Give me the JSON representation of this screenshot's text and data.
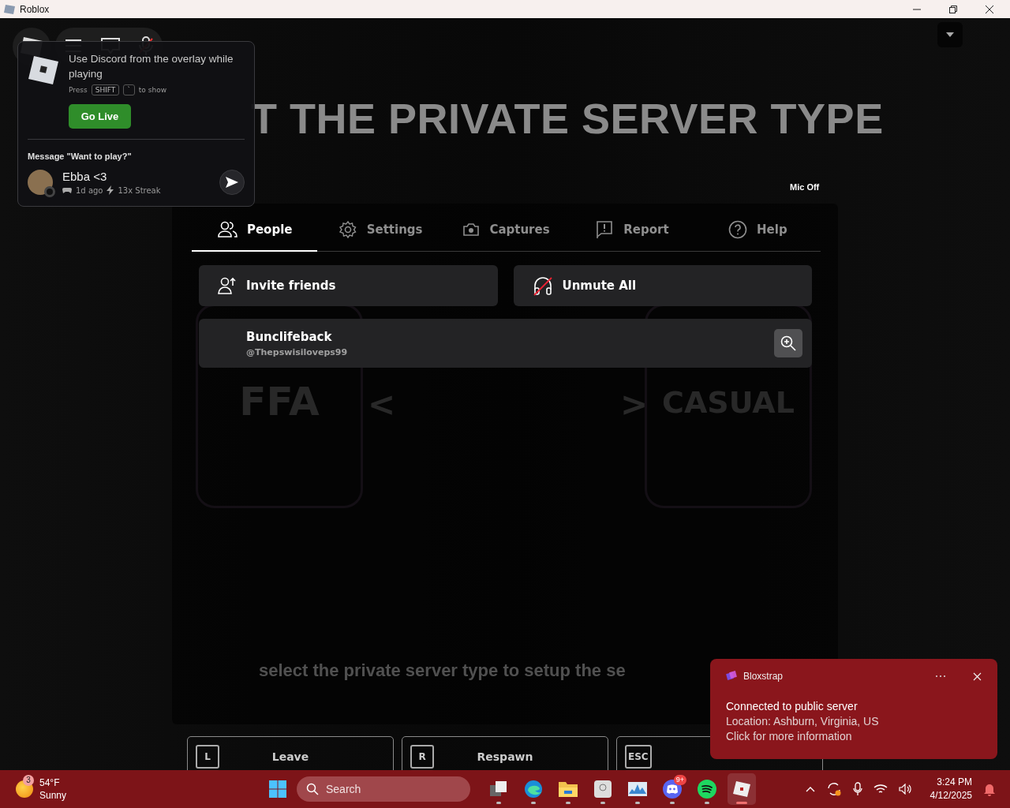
{
  "window": {
    "title": "Roblox"
  },
  "discord_overlay": {
    "message": "Use Discord from the overlay while playing",
    "hint_prefix": "Press",
    "keys": [
      "SHIFT",
      "`"
    ],
    "hint_suffix": "to show",
    "go_live": "Go Live",
    "prompt": "Message \"Want to play?\"",
    "friend": {
      "name": "Ebba <3",
      "last_played": "1d ago",
      "streak": "13x Streak"
    }
  },
  "game": {
    "headline": "T THE PRIVATE SERVER TYPE",
    "mic_status": "Mic Off",
    "modes": [
      {
        "label": "FFA"
      },
      {
        "label": "CASUAL"
      }
    ],
    "prev": "<",
    "next": ">",
    "subtitle": "select the private server type to setup the se",
    "actions": [
      {
        "key": "L",
        "label": "Leave"
      },
      {
        "key": "R",
        "label": "Respawn"
      },
      {
        "key": "ESC"
      }
    ]
  },
  "menu": {
    "tabs": [
      {
        "label": "People",
        "kind": "people",
        "selected": true
      },
      {
        "label": "Settings",
        "kind": "gear",
        "selected": false
      },
      {
        "label": "Captures",
        "kind": "camera",
        "selected": false
      },
      {
        "label": "Report",
        "kind": "flag",
        "selected": false
      },
      {
        "label": "Help",
        "kind": "help",
        "selected": false
      }
    ],
    "buttons": [
      {
        "label": "Invite friends",
        "kind": "invite"
      },
      {
        "label": "Unmute All",
        "kind": "unmute"
      }
    ],
    "players": [
      {
        "display_name": "Bunclifeback",
        "username": "@Thepswisiloveps99"
      }
    ]
  },
  "toast": {
    "app": "Bloxstrap",
    "title": "Connected to public server",
    "lines": [
      "Location: Ashburn, Virginia, US",
      "Click for more information"
    ]
  },
  "taskbar": {
    "weather": {
      "badge": "3",
      "temp": "54°F",
      "condition": "Sunny"
    },
    "search": {
      "placeholder": "Search"
    },
    "apps": [
      {
        "kind": "taskview",
        "selected": false
      },
      {
        "kind": "browser",
        "selected": false
      },
      {
        "kind": "folder",
        "selected": false
      },
      {
        "kind": "disk",
        "selected": false
      },
      {
        "kind": "monitor",
        "selected": false
      },
      {
        "kind": "chat",
        "badge": "9+",
        "selected": false
      },
      {
        "kind": "music",
        "selected": false
      },
      {
        "kind": "game",
        "selected": true
      }
    ],
    "time": "3:24 PM",
    "date": "4/12/2025"
  }
}
